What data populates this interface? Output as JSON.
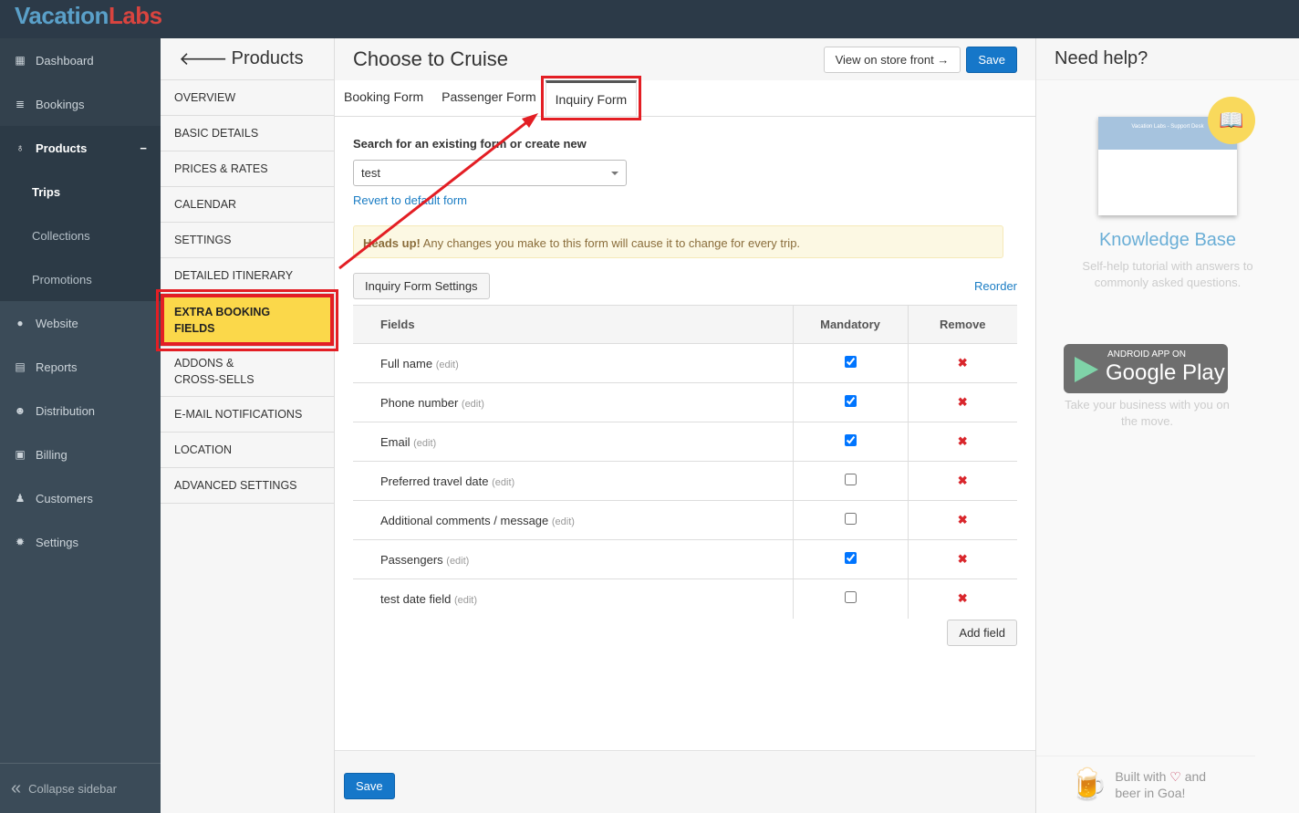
{
  "brand": {
    "part1": "Vacation",
    "part2": "Labs"
  },
  "sidebar": {
    "items": [
      {
        "label": "Dashboard",
        "icon": "calendar-icon"
      },
      {
        "label": "Bookings",
        "icon": "list-icon"
      },
      {
        "label": "Products",
        "icon": "lightbulb-icon",
        "expanded": "−"
      },
      {
        "label": "Trips"
      },
      {
        "label": "Collections"
      },
      {
        "label": "Promotions"
      },
      {
        "label": "Website",
        "icon": "globe-icon"
      },
      {
        "label": "Reports",
        "icon": "report-icon"
      },
      {
        "label": "Distribution",
        "icon": "users-icon"
      },
      {
        "label": "Billing",
        "icon": "money-icon"
      },
      {
        "label": "Customers",
        "icon": "user-icon"
      },
      {
        "label": "Settings",
        "icon": "gear-icon"
      }
    ],
    "collapse": "Collapse sidebar"
  },
  "subnav": {
    "title": "Products",
    "items": [
      "OVERVIEW",
      "BASIC DETAILS",
      "PRICES & RATES",
      "CALENDAR",
      "SETTINGS",
      "DETAILED ITINERARY",
      "EXTRA BOOKING FIELDS",
      "ADDONS & CROSS-SELLS",
      "E-MAIL NOTIFICATIONS",
      "LOCATION",
      "ADVANCED SETTINGS"
    ]
  },
  "main": {
    "title": "Choose to Cruise",
    "view_store": "View on store front →",
    "save": "Save",
    "tabs": [
      "Booking Form",
      "Passenger Form",
      "Inquiry Form"
    ],
    "search_label": "Search for an existing form or create new",
    "select_value": "test",
    "revert": "Revert to default form",
    "alert_strong": "Heads up!",
    "alert_text": " Any changes you make to this form will cause it to change for every trip.",
    "settings_btn": "Inquiry Form Settings",
    "reorder": "Reorder",
    "columns": [
      "Fields",
      "Mandatory",
      "Remove"
    ],
    "edit": "(edit)",
    "rows": [
      {
        "name": "Full name",
        "mandatory": true
      },
      {
        "name": "Phone number",
        "mandatory": true
      },
      {
        "name": "Email",
        "mandatory": true
      },
      {
        "name": "Preferred travel date",
        "mandatory": false
      },
      {
        "name": "Additional comments / message",
        "mandatory": false
      },
      {
        "name": "Passengers",
        "mandatory": true
      },
      {
        "name": "test date field",
        "mandatory": false
      }
    ],
    "add_field": "Add field",
    "footer_save": "Save"
  },
  "help": {
    "title": "Need help?",
    "kb_title": "Knowledge Base",
    "kb_text": "Self-help tutorial with answers to commonly asked questions.",
    "kb_preview": "Vacation Labs - Support Desk",
    "gp_top": "ANDROID APP ON",
    "gp_main": "Google Play",
    "gp_text": "Take your business with you on the move.",
    "built1": "Built with",
    "built2": "and",
    "built3": "beer in Goa!"
  }
}
